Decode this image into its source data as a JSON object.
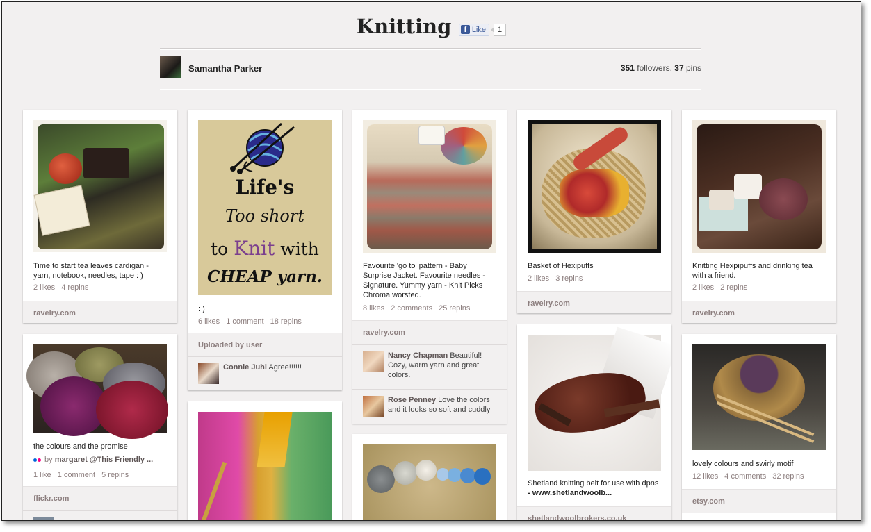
{
  "board": {
    "title": "Knitting",
    "like_label": "Like",
    "like_count": "1"
  },
  "owner": {
    "name": "Samantha Parker",
    "followers": "351",
    "followers_label": "followers,",
    "pins": "37",
    "pins_label": "pins"
  },
  "pins": [
    {
      "description": "Time to start tea leaves cardigan - yarn, notebook, needles, tape : )",
      "likes": "2 likes",
      "repins": "4 repins",
      "source": "ravelry.com"
    },
    {
      "description": ": )",
      "likes": "6 likes",
      "comments": "1 comment",
      "repins": "18 repins",
      "source": "Uploaded by user",
      "poster": {
        "line1": "Life's",
        "line2": "Too short",
        "line3a": "to ",
        "line3b": "Knit",
        "line3c": " with",
        "line4": "CHEAP yarn."
      },
      "comment": {
        "name": "Connie Juhl",
        "text": "Agree!!!!!!"
      }
    },
    {
      "description": "Favourite 'go to' pattern - Baby Surprise Jacket. Favourite needles - Signature. Yummy yarn - Knit Picks Chroma worsted.",
      "likes": "8 likes",
      "comments": "2 comments",
      "repins": "25 repins",
      "source": "ravelry.com",
      "comments_list": [
        {
          "name": "Nancy Chapman",
          "text": "Beautiful! Cozy, warm yarn and great colors."
        },
        {
          "name": "Rose Penney",
          "text": "Love the colors and it looks so soft and cuddly"
        }
      ]
    },
    {
      "description": "Basket of Hexipuffs",
      "likes": "2 likes",
      "repins": "3 repins",
      "source": "ravelry.com"
    },
    {
      "description": "Knitting Hexpipuffs and drinking tea with a friend.",
      "likes": "2 likes",
      "repins": "2 repins",
      "source": "ravelry.com"
    },
    {
      "description": "the colours and the promise",
      "pinner_prefix": "by",
      "pinner_name": "margaret @This Friendly ...",
      "likes": "1 like",
      "comments": "1 comment",
      "repins": "5 repins",
      "source": "flickr.com"
    },
    {
      "description": "Shetland knitting belt for use with dpns",
      "link": "- www.shetlandwoolb...",
      "source": "shetlandwoolbrokers.co.uk"
    },
    {
      "description": "lovely colours and swirly motif",
      "likes": "12 likes",
      "comments": "4 comments",
      "repins": "32 repins",
      "source": "etsy.com"
    }
  ],
  "colors": {
    "page_bg": "#f2f0f0",
    "poster_bg": "#d8c99a",
    "poster_accent": "#7b3f8e",
    "facebook_blue": "#3b5998"
  }
}
